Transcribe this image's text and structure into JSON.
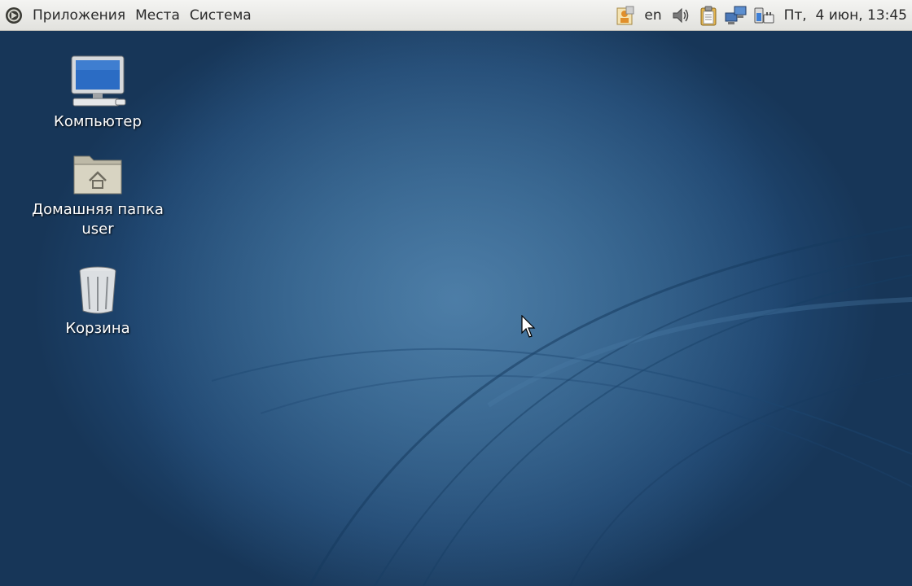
{
  "panel": {
    "menus": [
      {
        "label": "Приложения"
      },
      {
        "label": "Места"
      },
      {
        "label": "Система"
      }
    ],
    "tray": {
      "icons": [
        "user-switch-icon",
        "volume-icon",
        "clipboard-icon",
        "network-icon",
        "power-icon"
      ],
      "language": "en",
      "clock": "Пт,  4 июн, 13:45"
    }
  },
  "desktop": {
    "icons": [
      {
        "name": "computer-icon",
        "label": "Компьютер"
      },
      {
        "name": "home-folder-icon",
        "label": "Домашняя папка\nuser"
      },
      {
        "name": "trash-icon",
        "label": "Корзина"
      }
    ]
  },
  "colors": {
    "panel_bg": "#e8e8e4",
    "desktop_bg": "#2d5a84",
    "label_text": "#ffffff"
  }
}
